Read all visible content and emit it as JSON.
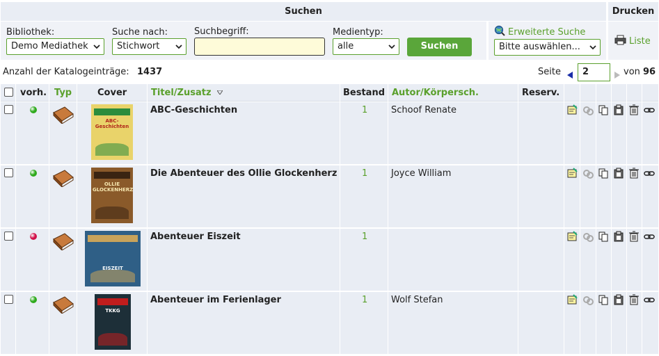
{
  "header": {
    "search_title": "Suchen",
    "print_title": "Drucken"
  },
  "filters": {
    "library_label": "Bibliothek:",
    "library_value": "Demo Mediathek",
    "searchby_label": "Suche nach:",
    "searchby_value": "Stichwort",
    "term_label": "Suchbegriff:",
    "term_value": "",
    "mediatype_label": "Medientyp:",
    "mediatype_value": "alle",
    "search_button": "Suchen",
    "advanced_link": "Erweiterte Suche",
    "advanced_select": "Bitte auswählen...",
    "list_link": "Liste"
  },
  "summary": {
    "count_label": "Anzahl der Katalogeinträge:",
    "count": "1437",
    "page_label": "Seite",
    "page": "2",
    "of_label": "von",
    "total_pages": "96"
  },
  "columns": {
    "avail": "vorh.",
    "type": "Typ",
    "cover": "Cover",
    "title": "Titel/Zusatz",
    "stock": "Bestand",
    "author": "Autor/Körpersch.",
    "reserve": "Reserv."
  },
  "colors": {
    "accent": "#5aa02c",
    "available": "#2eaa1c",
    "unavailable": "#d1124a"
  },
  "rows": [
    {
      "title": "ABC-Geschichten",
      "stock": "1",
      "author": "Schoof Renate",
      "available": true,
      "cover_text": "ABC-Geschichten"
    },
    {
      "title": "Die Abenteuer des Ollie Glockenherz",
      "stock": "1",
      "author": "Joyce William",
      "available": true,
      "cover_text": "OLLIE GLOCKENHERZ"
    },
    {
      "title": "Abenteuer Eiszeit",
      "stock": "1",
      "author": "",
      "available": false,
      "cover_text": "EISZEIT"
    },
    {
      "title": "Abenteuer im Ferienlager",
      "stock": "1",
      "author": "Wolf Stefan",
      "available": true,
      "cover_text": "TKKG"
    }
  ]
}
